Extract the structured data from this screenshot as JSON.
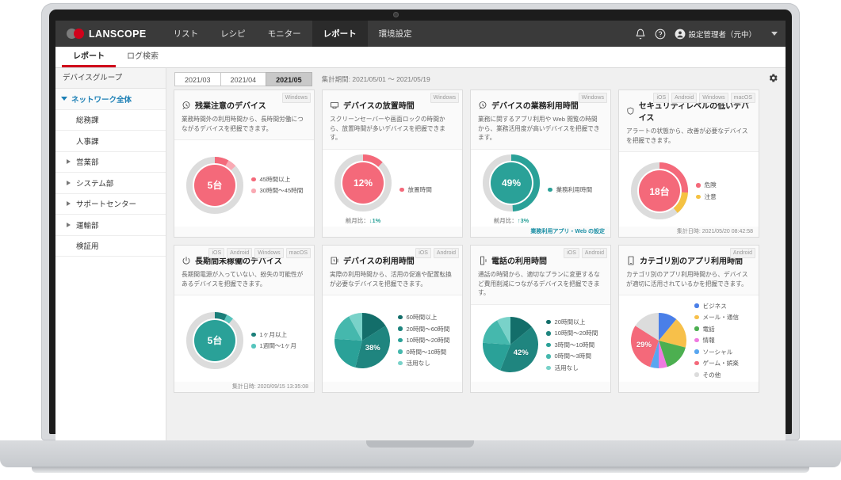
{
  "app": {
    "brand": "LANSCOPE",
    "nav": [
      {
        "label": "リスト",
        "active": false
      },
      {
        "label": "レシピ",
        "active": false
      },
      {
        "label": "モニター",
        "active": false
      },
      {
        "label": "レポート",
        "active": true
      },
      {
        "label": "環境設定",
        "active": false
      }
    ],
    "icons": {
      "bell": "bell-icon",
      "help": "help-icon",
      "user": "user-icon",
      "gear": "gear-icon"
    },
    "user_name": "設定管理者（元中）"
  },
  "subtabs": [
    {
      "label": "レポート",
      "active": true
    },
    {
      "label": "ログ検索",
      "active": false
    }
  ],
  "sidebar": {
    "header": "デバイスグループ",
    "items": [
      {
        "label": "ネットワーク全体",
        "level": "root",
        "arrow": "down"
      },
      {
        "label": "総務課",
        "level": "child",
        "arrow": "none"
      },
      {
        "label": "人事課",
        "level": "child",
        "arrow": "none"
      },
      {
        "label": "営業部",
        "level": "child",
        "arrow": "right"
      },
      {
        "label": "システム部",
        "level": "child",
        "arrow": "right"
      },
      {
        "label": "サポートセンター",
        "level": "child",
        "arrow": "right"
      },
      {
        "label": "運輸部",
        "level": "child",
        "arrow": "right"
      },
      {
        "label": "検証用",
        "level": "child",
        "arrow": "none"
      }
    ]
  },
  "filterbar": {
    "periods": [
      {
        "label": "2021/03",
        "active": false
      },
      {
        "label": "2021/04",
        "active": false
      },
      {
        "label": "2021/05",
        "active": true
      }
    ],
    "range_text": "集計期間: 2021/05/01 ～ 2021/05/19"
  },
  "colors": {
    "red": "#d0021b",
    "pink": "#f4697a",
    "pink_light": "#f9a9b3",
    "teal": "#2aa198",
    "teal_dark": "#1b7f7a",
    "track": "#dcdcdc",
    "amber": "#f5c242",
    "link": "#1b8fa5"
  },
  "cards": [
    {
      "id": "overtime-devices",
      "icon": "clock-alert-icon",
      "title": "残業注意のデバイス",
      "desc": "業務時間外の利用時間から、長時間労働につながるデバイスを把握できます。",
      "badges": [
        "Windows"
      ],
      "chart_data": {
        "type": "pie",
        "variant": "donut",
        "center_value": "5台",
        "center_color": "#f4697a",
        "categories": [
          "45時間以上",
          "30時間〜45時間"
        ],
        "values": [
          8,
          5
        ],
        "rest": 87,
        "colors": [
          "#f4697a",
          "#f9a9b3"
        ],
        "track_color": "#dcdcdc"
      },
      "footer": ""
    },
    {
      "id": "idle-time",
      "icon": "monitor-icon",
      "title": "デバイスの放置時間",
      "desc": "スクリーンセーバーや画面ロックの時間から、放置時間が多いデバイスを把握できます。",
      "badges": [
        "Windows"
      ],
      "chart_data": {
        "type": "pie",
        "variant": "donut",
        "center_value": "12%",
        "center_color": "#f4697a",
        "categories": [
          "放置時間"
        ],
        "values": [
          12
        ],
        "rest": 88,
        "colors": [
          "#f4697a"
        ],
        "track_color": "#dcdcdc"
      },
      "delta_label": "前月比：",
      "delta_value": "↓1%",
      "delta_color": "#2aa198",
      "footer": ""
    },
    {
      "id": "business-usage",
      "icon": "clock-check-icon",
      "title": "デバイスの業務利用時間",
      "desc": "業務に関するアプリ利用や Web 閲覧の時間から、業務活用度が高いデバイスを把握できます。",
      "badges": [
        "Windows"
      ],
      "chart_data": {
        "type": "pie",
        "variant": "donut",
        "center_value": "49%",
        "center_color": "#2aa198",
        "categories": [
          "業務利用時間"
        ],
        "values": [
          49
        ],
        "rest": 51,
        "colors": [
          "#2aa198"
        ],
        "track_color": "#dcdcdc"
      },
      "delta_label": "前月比：",
      "delta_value": "↑3%",
      "delta_color": "#2aa198",
      "footer": "業務利用アプリ・Web の設定",
      "footer_is_link": true
    },
    {
      "id": "low-security-devices",
      "icon": "shield-icon",
      "title": "セキュリティレベルの低いデバイス",
      "desc": "アラートの状態から、改善が必要なデバイスを把握できます。",
      "badges": [
        "iOS",
        "Android",
        "Windows",
        "macOS"
      ],
      "chart_data": {
        "type": "pie",
        "variant": "donut",
        "center_value": "18台",
        "center_color": "#f4697a",
        "categories": [
          "危険",
          "注意"
        ],
        "values": [
          26,
          13
        ],
        "rest": 61,
        "colors": [
          "#f4697a",
          "#f5c242"
        ],
        "track_color": "#dcdcdc"
      },
      "footer": "集計日時: 2021/05/20 08:42:58"
    },
    {
      "id": "long-inactive-devices",
      "icon": "power-icon",
      "title": "長期間未稼働のデバイス",
      "desc": "長期間電源が入っていない、紛失の可能性があるデバイスを把握できます。",
      "badges": [
        "iOS",
        "Android",
        "Windows",
        "macOS"
      ],
      "chart_data": {
        "type": "pie",
        "variant": "donut",
        "center_value": "5台",
        "center_color": "#2aa198",
        "categories": [
          "1ヶ月以上",
          "1週間〜1ヶ月"
        ],
        "values": [
          7,
          4
        ],
        "rest": 89,
        "colors": [
          "#1b7f7a",
          "#56c5bd"
        ],
        "track_color": "#dcdcdc"
      },
      "footer": "集計日時: 2020/09/15 13:35:08"
    },
    {
      "id": "device-usage-time",
      "icon": "clock-device-icon",
      "title": "デバイスの利用時間",
      "desc": "実際の利用時間から、活用の促進や配置転換が必要なデバイスを把握できます。",
      "badges": [
        "iOS",
        "Android"
      ],
      "chart_data": {
        "type": "pie",
        "variant": "pie",
        "main_label": "38%",
        "categories": [
          "60時間以上",
          "20時間〜60時間",
          "10時間〜20時間",
          "0時間〜10時間",
          "活用なし"
        ],
        "values": [
          16,
          38,
          22,
          16,
          8
        ],
        "colors": [
          "#136e6a",
          "#1f857f",
          "#2aa198",
          "#45b8ad",
          "#79d2c9"
        ]
      },
      "footer": ""
    },
    {
      "id": "phone-usage-time",
      "icon": "phone-icon",
      "title": "電話の利用時間",
      "desc": "通話の時間から、適切なプランに変更するなど費用削減につながるデバイスを把握できます。",
      "badges": [
        "iOS",
        "Android"
      ],
      "chart_data": {
        "type": "pie",
        "variant": "pie",
        "main_label": "42%",
        "categories": [
          "20時間以上",
          "10時間〜20時間",
          "3時間〜10時間",
          "0時間〜3時間",
          "活用なし"
        ],
        "values": [
          14,
          42,
          20,
          16,
          8
        ],
        "colors": [
          "#136e6a",
          "#1f857f",
          "#2aa198",
          "#45b8ad",
          "#79d2c9"
        ]
      },
      "footer": ""
    },
    {
      "id": "app-usage-by-category",
      "icon": "tablet-icon",
      "title": "カテゴリ別のアプリ利用時間",
      "desc": "カテゴリ別のアプリ利用時間から、デバイスが適切に活用されているかを把握できます。",
      "badges": [
        "Android"
      ],
      "chart_data": {
        "type": "pie",
        "variant": "pie",
        "main_label": "29%",
        "categories": [
          "ビジネス",
          "メール・通信",
          "電話",
          "情報",
          "ソーシャル",
          "ゲーム・娯楽",
          "その他"
        ],
        "values": [
          11,
          18,
          16,
          5,
          5,
          29,
          16
        ],
        "colors": [
          "#4a7fe8",
          "#f7c04a",
          "#4caf50",
          "#ef7ae0",
          "#58a6f0",
          "#f4697a",
          "#dcdcdc"
        ]
      },
      "footer": ""
    }
  ]
}
